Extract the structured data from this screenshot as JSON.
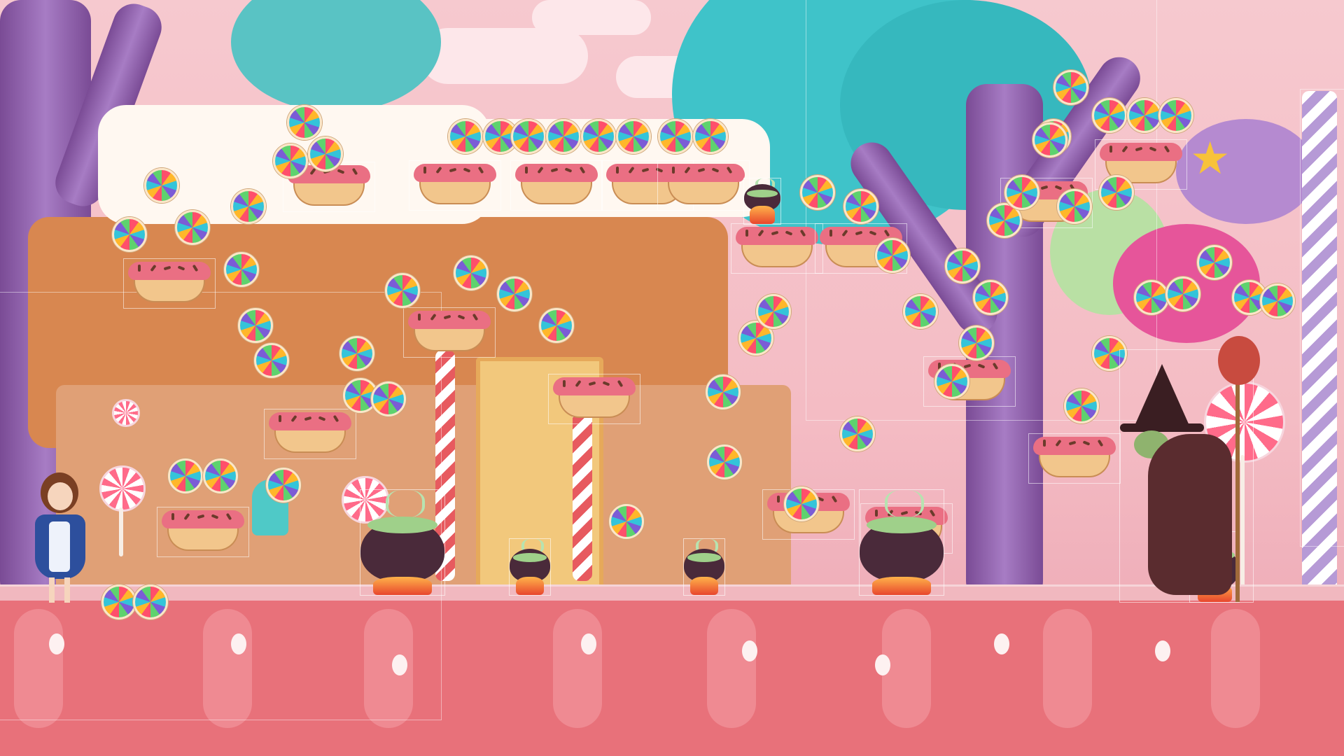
{
  "scene": {
    "name": "candy-forest-level",
    "colors": {
      "sky": "#f6c9cf",
      "ground": "#e8717a",
      "platform_icing": "#ea6f83",
      "platform_cake": "#f2c68c",
      "tree": "#8e5cae",
      "foliage": "#3fc3c9"
    }
  },
  "player": {
    "icon": "girl-character-icon",
    "outfit_color": "#2d4f9d"
  },
  "enemy": {
    "icon": "witch-character-icon",
    "cloak_color": "#5a2c2f"
  },
  "collectibles": {
    "icon": "rainbow-lollipop-coin-icon",
    "count": 62
  },
  "platforms": {
    "icon": "cake-platform-icon",
    "count": 19
  },
  "hazards": {
    "icon": "cauldron-icon",
    "count": 6
  }
}
